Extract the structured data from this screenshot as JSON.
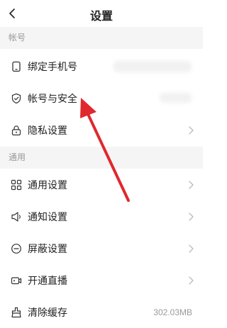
{
  "header": {
    "title": "设置"
  },
  "sections": [
    {
      "header": "帐号"
    },
    {
      "header": "通用"
    }
  ],
  "account_items": [
    {
      "label": "绑定手机号",
      "icon": "phone-icon"
    },
    {
      "label": "帐号与安全",
      "icon": "shield-check-icon"
    },
    {
      "label": "隐私设置",
      "icon": "lock-icon"
    }
  ],
  "general_items": [
    {
      "label": "通用设置",
      "icon": "grid-icon"
    },
    {
      "label": "通知设置",
      "icon": "speaker-icon"
    },
    {
      "label": "屏蔽设置",
      "icon": "minus-circle-icon"
    },
    {
      "label": "开通直播",
      "icon": "video-camera-icon"
    },
    {
      "label": "清除缓存",
      "icon": "broom-icon",
      "value": "302.03MB"
    }
  ],
  "colors": {
    "arrow": "#e0282e",
    "section_bg": "#f5f5f5",
    "muted_text": "#999999"
  }
}
